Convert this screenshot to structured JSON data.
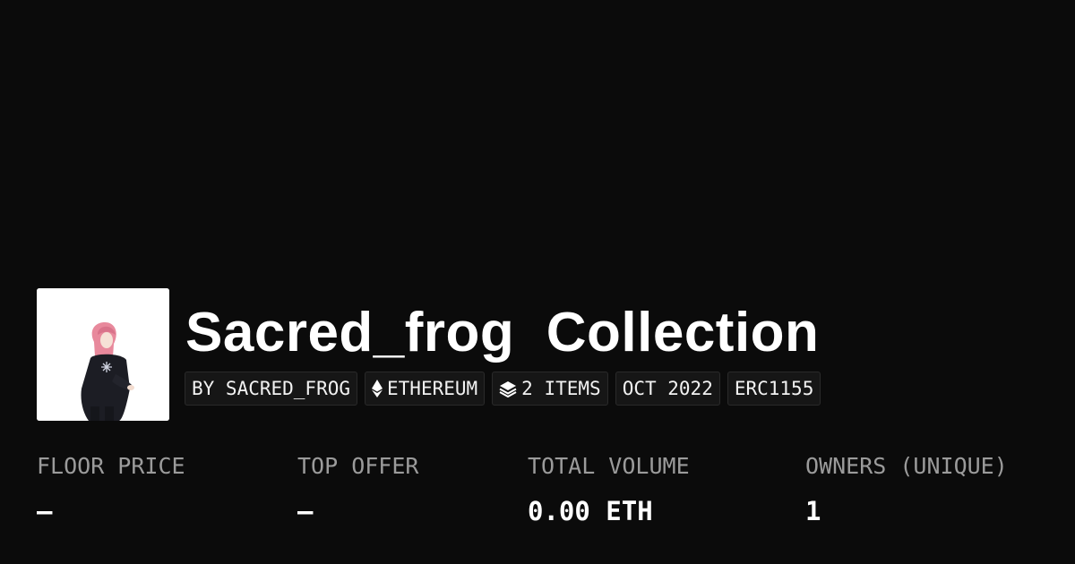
{
  "collection": {
    "title": "Sacred_frog  Collection",
    "badges": {
      "creator": "BY SACRED_FROG",
      "chain": "ETHEREUM",
      "items": "2 ITEMS",
      "date": "OCT 2022",
      "standard": "ERC1155"
    },
    "icons": {
      "chain": "ethereum-icon",
      "items": "layers-icon"
    }
  },
  "stats": {
    "floor_price": {
      "label": "FLOOR PRICE",
      "value": "–"
    },
    "top_offer": {
      "label": "TOP OFFER",
      "value": "–"
    },
    "total_volume": {
      "label": "TOTAL VOLUME",
      "value": "0.00 ETH"
    },
    "owners": {
      "label": "OWNERS (UNIQUE)",
      "value": "1"
    }
  },
  "colors": {
    "background": "#0b0b0b",
    "badge_background": "#161616",
    "label_gray": "#9b9b9b"
  }
}
